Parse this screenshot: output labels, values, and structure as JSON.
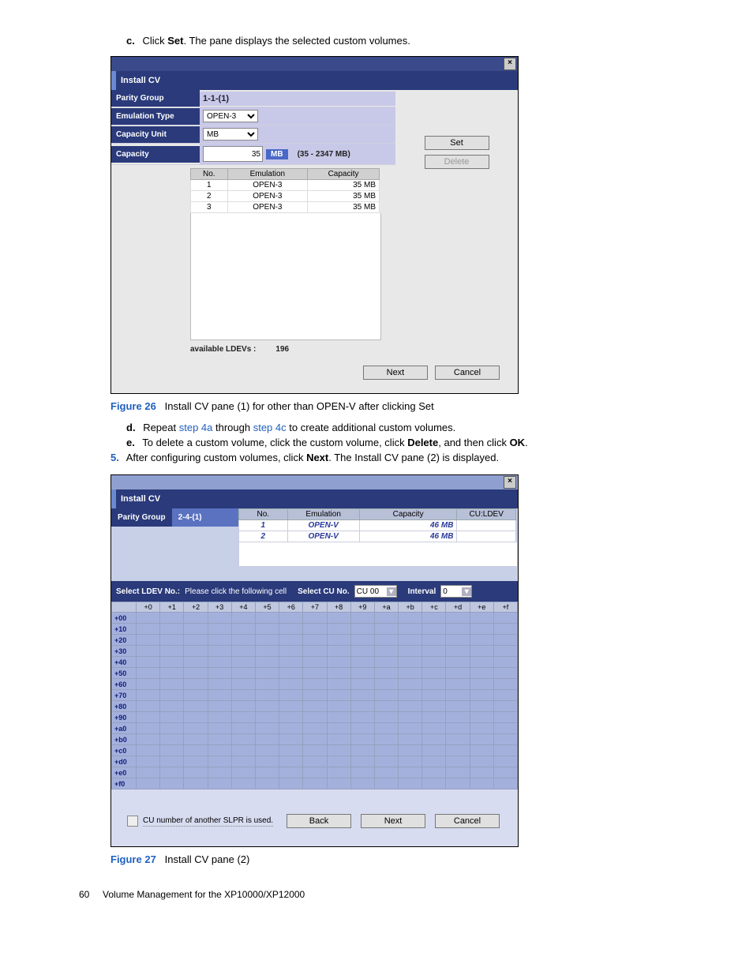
{
  "intro": {
    "c_letter": "c.",
    "c_text_1": "Click ",
    "c_bold": "Set",
    "c_text_2": ". The pane displays the selected custom volumes."
  },
  "dlg1": {
    "install_cv": "Install CV",
    "labels": {
      "parity_group": "Parity Group",
      "emulation_type": "Emulation Type",
      "capacity_unit": "Capacity Unit",
      "capacity": "Capacity"
    },
    "values": {
      "parity_group": "1-1-(1)",
      "emulation_type": "OPEN-3",
      "capacity_unit": "MB",
      "capacity_input": "35",
      "mb_chip": "MB",
      "range": "(35 - 2347 MB)"
    },
    "buttons": {
      "set": "Set",
      "delete": "Delete",
      "next": "Next",
      "cancel": "Cancel"
    },
    "mini_headers": {
      "no": "No.",
      "emulation": "Emulation",
      "capacity": "Capacity"
    },
    "mini_rows": [
      {
        "no": "1",
        "emu": "OPEN-3",
        "cap": "35 MB"
      },
      {
        "no": "2",
        "emu": "OPEN-3",
        "cap": "35 MB"
      },
      {
        "no": "3",
        "emu": "OPEN-3",
        "cap": "35 MB"
      }
    ],
    "avail_label": "available LDEVs :",
    "avail_value": "196"
  },
  "fig26": {
    "label": "Figure 26",
    "caption": "Install CV pane (1) for other than OPEN-V after clicking Set"
  },
  "steps": {
    "d_letter": "d.",
    "d_1": "Repeat ",
    "d_link1": "step 4a",
    "d_mid": " through ",
    "d_link2": "step 4c",
    "d_2": " to create additional custom volumes.",
    "e_letter": "e.",
    "e_1": "To delete a custom volume, click the custom volume, click ",
    "e_b1": "Delete",
    "e_mid": ", and then click ",
    "e_b2": "OK",
    "e_end": ".",
    "five": "5.",
    "five_1": "After configuring custom volumes, click ",
    "five_b": "Next",
    "five_2": ". The Install CV pane (2) is displayed."
  },
  "dlg2": {
    "install_cv": "Install CV",
    "parity_group_label": "Parity Group",
    "parity_group_value": "2-4-(1)",
    "headers": {
      "no": "No.",
      "emulation": "Emulation",
      "capacity": "Capacity",
      "culdev": "CU:LDEV"
    },
    "rows": [
      {
        "no": "1",
        "emu": "OPEN-V",
        "cap": "46 MB",
        "cl": ""
      },
      {
        "no": "2",
        "emu": "OPEN-V",
        "cap": "46 MB",
        "cl": ""
      }
    ],
    "sel_ldev_label": "Select LDEV No.:",
    "sel_ldev_hint": "Please click the following cell",
    "sel_cu_label": "Select CU No.",
    "sel_cu_value": "CU 00",
    "interval_label": "Interval",
    "interval_value": "0",
    "cols": [
      "+0",
      "+1",
      "+2",
      "+3",
      "+4",
      "+5",
      "+6",
      "+7",
      "+8",
      "+9",
      "+a",
      "+b",
      "+c",
      "+d",
      "+e",
      "+f"
    ],
    "row_heads": [
      "+00",
      "+10",
      "+20",
      "+30",
      "+40",
      "+50",
      "+60",
      "+70",
      "+80",
      "+90",
      "+a0",
      "+b0",
      "+c0",
      "+d0",
      "+e0",
      "+f0"
    ],
    "chk_label": "CU number of another SLPR is used.",
    "buttons": {
      "back": "Back",
      "next": "Next",
      "cancel": "Cancel"
    }
  },
  "fig27": {
    "label": "Figure 27",
    "caption": "Install CV pane (2)"
  },
  "footer": {
    "page": "60",
    "title": "Volume Management for the XP10000/XP12000"
  }
}
